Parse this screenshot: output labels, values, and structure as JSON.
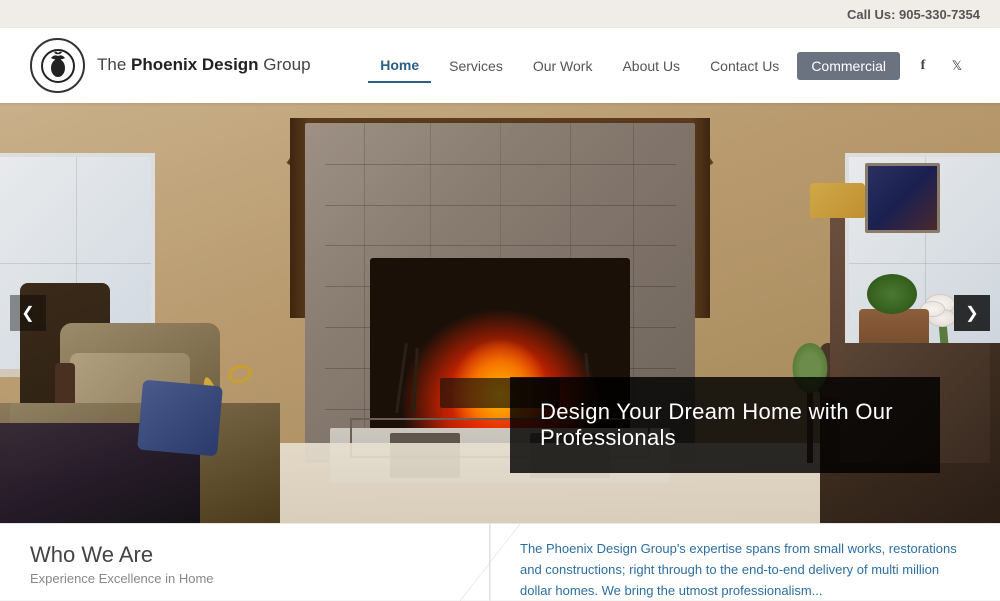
{
  "topbar": {
    "call_label": "Call Us:",
    "phone": "905-330-7354"
  },
  "header": {
    "logo_text_pre": "The ",
    "logo_text_bold": "Phoenix Design",
    "logo_text_post": " Group",
    "logo_icon": "🐦"
  },
  "nav": {
    "items": [
      {
        "label": "Home",
        "active": true
      },
      {
        "label": "Services",
        "active": false
      },
      {
        "label": "Our Work",
        "active": false
      },
      {
        "label": "About Us",
        "active": false
      },
      {
        "label": "Contact Us",
        "active": false
      },
      {
        "label": "Commercial",
        "active": false,
        "style": "commercial"
      }
    ],
    "social": [
      {
        "icon": "f",
        "name": "facebook"
      },
      {
        "icon": "🐦",
        "name": "twitter"
      }
    ]
  },
  "hero": {
    "caption": "Design Your Dream Home with Our Professionals",
    "arrow_left": "❮",
    "arrow_right": "❯"
  },
  "bottom": {
    "who_title": "Who We Are",
    "who_sub": "Experience Excellence in Home",
    "description": "The Phoenix Design Group's expertise spans from small works, restorations and constructions; right through to the end-to-end delivery of multi million dollar homes. We bring the utmost professionalism..."
  }
}
